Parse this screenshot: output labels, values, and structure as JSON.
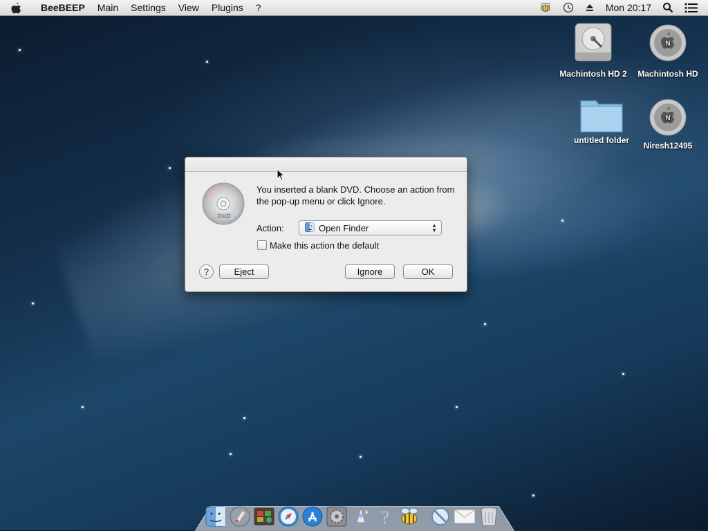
{
  "menubar": {
    "app_name": "BeeBEEP",
    "items": [
      "Main",
      "Settings",
      "View",
      "Plugins",
      "?"
    ],
    "clock": "Mon 20:17"
  },
  "desktop": {
    "icons": [
      {
        "label": "Machintosh HD 2",
        "icon": "hard-drive-icon"
      },
      {
        "label": "Machintosh HD",
        "icon": "disk-icon"
      },
      {
        "label": "untitled folder",
        "icon": "folder-icon"
      },
      {
        "label": "Niresh12495",
        "icon": "disk-icon"
      }
    ]
  },
  "dialog": {
    "message": "You inserted a blank DVD. Choose an action from the pop-up menu or click Ignore.",
    "action_label": "Action:",
    "action_value": "Open Finder",
    "checkbox_label": "Make this action the default",
    "checkbox_checked": false,
    "help_label": "?",
    "eject_label": "Eject",
    "ignore_label": "Ignore",
    "ok_label": "OK"
  },
  "dock": {
    "items": [
      "finder-icon",
      "launchpad-icon",
      "photo-booth-icon",
      "safari-icon",
      "app-store-icon",
      "system-preferences-icon",
      "wizard-icon",
      "help-icon",
      "beebeep-icon",
      "blocked-icon",
      "mail-icon",
      "trash-icon"
    ]
  }
}
